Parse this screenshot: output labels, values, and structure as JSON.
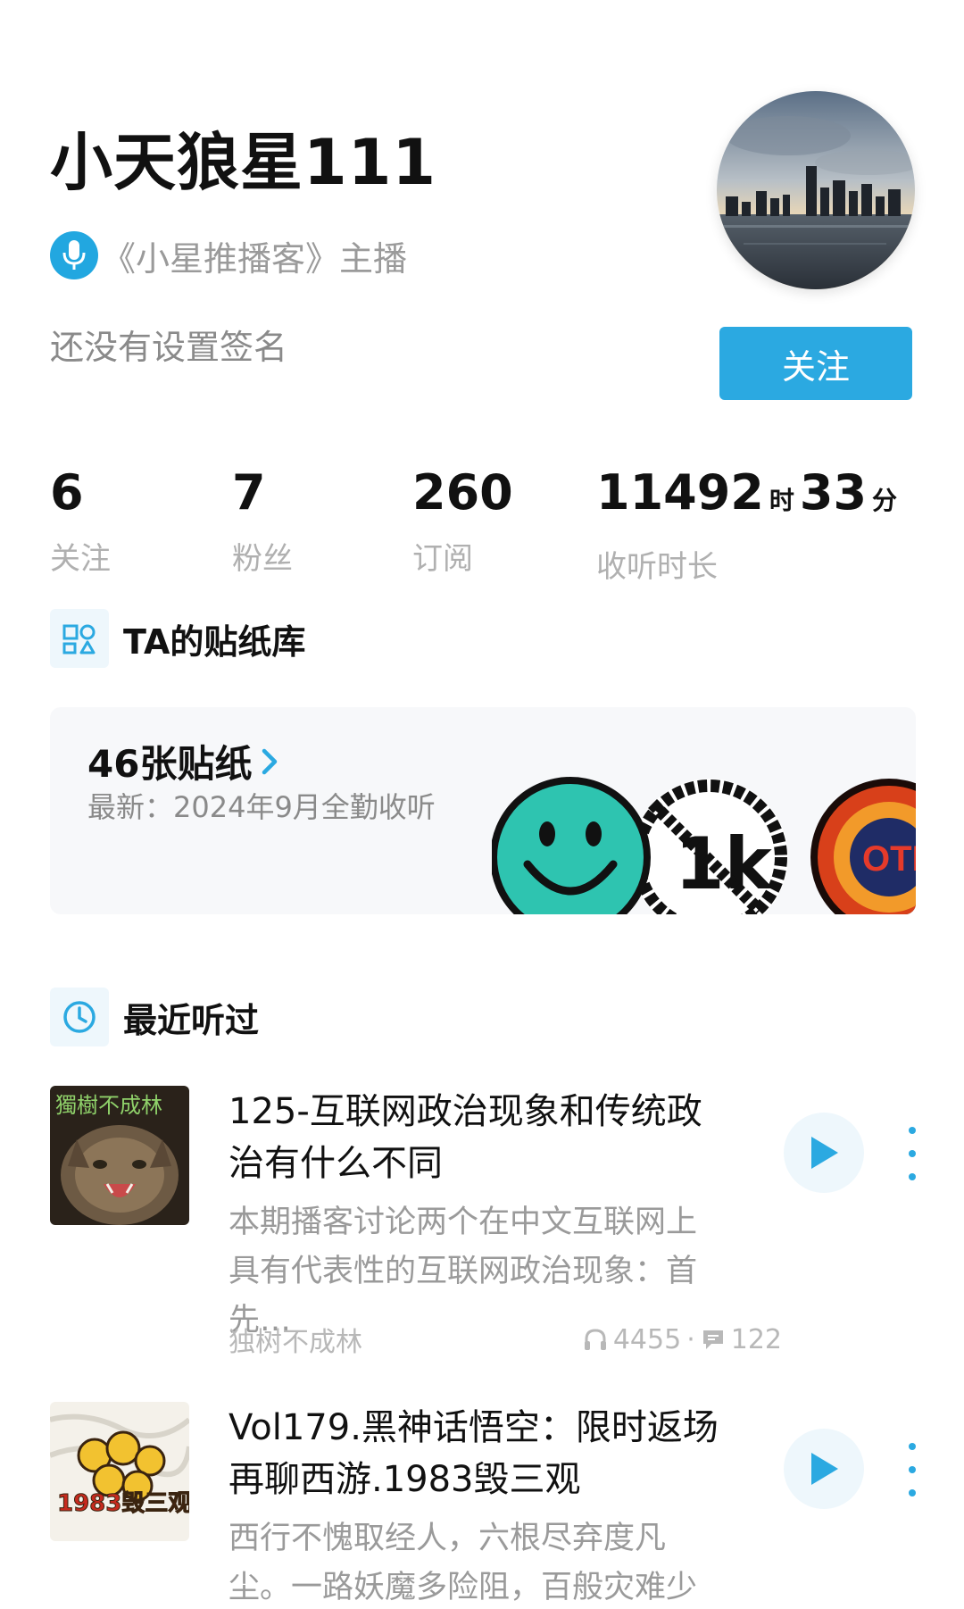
{
  "profile": {
    "username": "小天狼星111",
    "host_label": "《小星推播客》主播",
    "signature": "还没有设置签名",
    "follow_label": "关注"
  },
  "stats": [
    {
      "value": "6",
      "label": "关注"
    },
    {
      "value": "7",
      "label": "粉丝"
    },
    {
      "value": "260",
      "label": "订阅"
    },
    {
      "hours": "11492",
      "hours_unit": "时",
      "minutes": "33",
      "minutes_unit": "分",
      "label": "收听时长"
    }
  ],
  "stickers": {
    "section_title": "TA的贴纸库",
    "count_label": "46张贴纸",
    "latest_label": "最新：2024年9月全勤收听"
  },
  "recent": {
    "section_title": "最近听过",
    "episodes": [
      {
        "title": "125-互联网政治现象和传统政治有什么不同",
        "description": "本期播客讨论两个在中文互联网上具有代表性的互联网政治现象：首先…",
        "podcast": "独树不成林",
        "plays": "4455",
        "comments": "122",
        "cover_text": "獨樹不成林"
      },
      {
        "title": "Vol179.黑神话悟空：限时返场再聊西游.1983毁三观",
        "description": "西行不愧取经人，六根尽弃度凡尘。一路妖魔多险阻，百般灾难少沉沦…",
        "cover_text": "1983毁三观"
      }
    ]
  },
  "colors": {
    "accent": "#2ba9e1",
    "muted": "#9a9a9a"
  }
}
